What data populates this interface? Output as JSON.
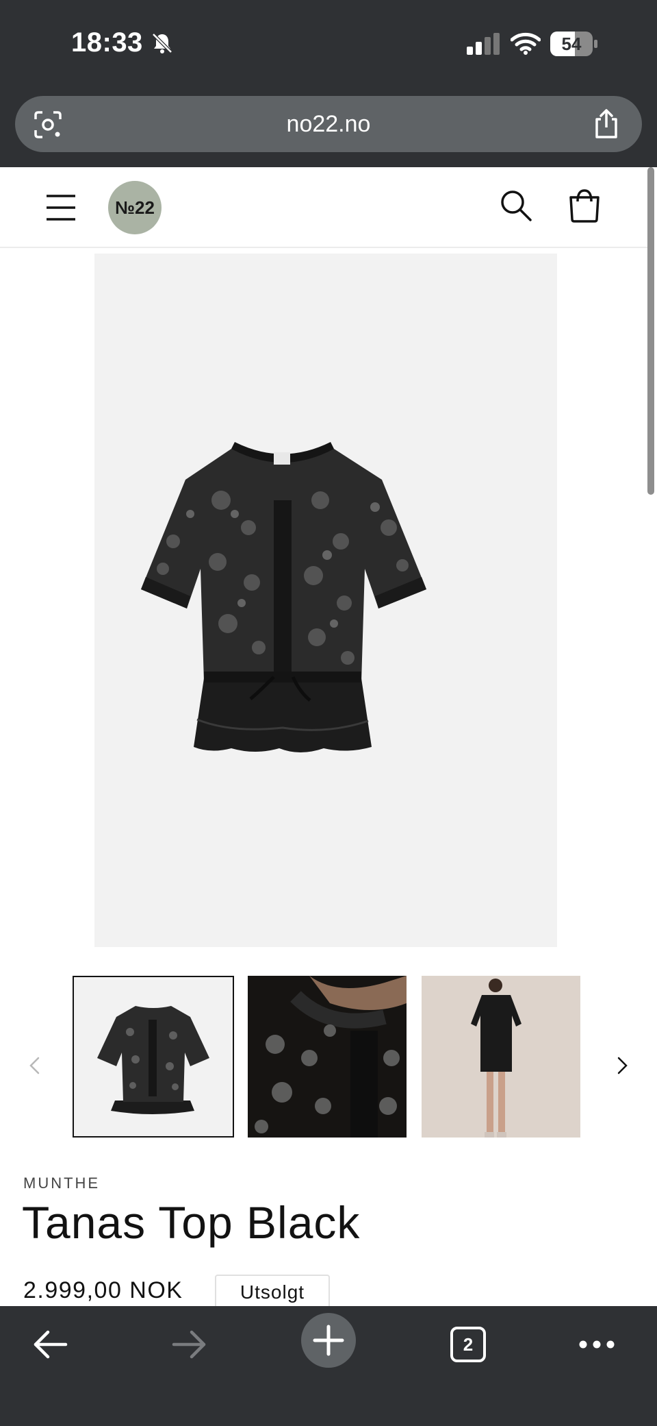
{
  "status_bar": {
    "time": "18:33",
    "battery": "54",
    "icons": [
      "bell-off-icon",
      "signal-icon",
      "wifi-icon",
      "battery-icon"
    ]
  },
  "browser": {
    "url": "no22.no",
    "icons": [
      "lens-icon",
      "share-icon"
    ]
  },
  "site_header": {
    "logo_text": "№22",
    "logo_color": "#aab3a4",
    "icons": [
      "menu-icon",
      "search-icon",
      "cart-icon"
    ]
  },
  "gallery": {
    "main_image": "black lace short-sleeve top with ruffled hem",
    "thumbnails": [
      "product-front",
      "detail-closeup",
      "model-full-body"
    ],
    "selected_thumbnail": 1,
    "icons": [
      "chevron-left-icon",
      "chevron-right-icon"
    ]
  },
  "product": {
    "vendor": "MUNTHE",
    "title": "Tanas Top Black",
    "price": "2.999,00 NOK",
    "badge": "Utsolgt"
  },
  "toolbar": {
    "open_tabs": "2",
    "icons": [
      "back-arrow-icon",
      "forward-arrow-icon",
      "new-tab-icon",
      "tabs-icon",
      "more-icon"
    ]
  }
}
